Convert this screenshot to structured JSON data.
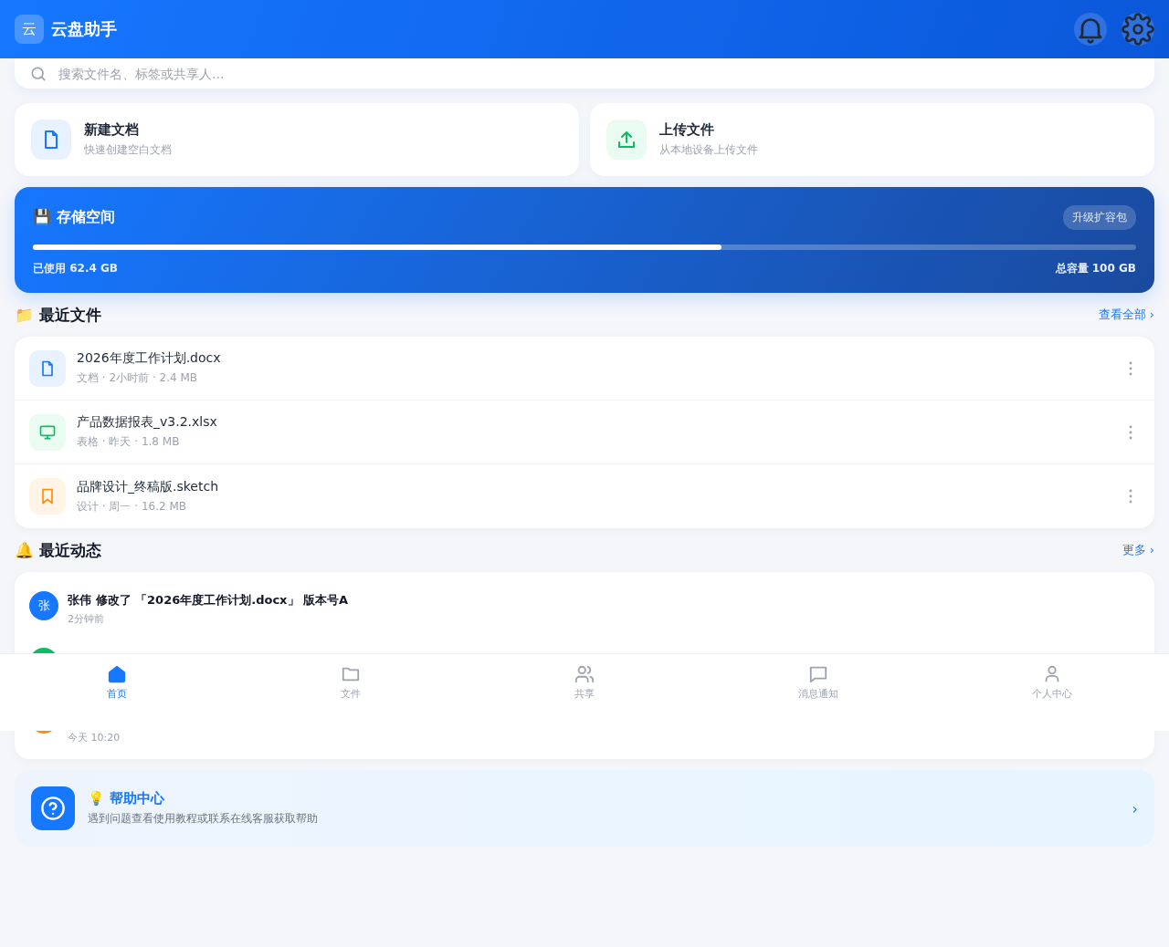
{
  "header": {
    "logo": "云",
    "title": "云盘助手"
  },
  "search": {
    "placeholder": "搜索文件名、标签或共享人..."
  },
  "quick_actions": [
    {
      "kind": "document",
      "title": "新建文档",
      "subtitle": "快速创建空白文档"
    },
    {
      "kind": "upload",
      "title": "上传文件",
      "subtitle": "从本地设备上传文件"
    }
  ],
  "storage": {
    "title": "💾 存储空间",
    "badge": "升级扩容包",
    "level": 0.624,
    "used": "已使用 62.4 GB",
    "total": "总容量 100 GB"
  },
  "recent_files": {
    "title": "📁 最近文件",
    "link": "查看全部 ›",
    "items": [
      {
        "kind": "document",
        "name": "2026年度工作计划.docx",
        "meta": "文档 · 2小时前 · 2.4 MB"
      },
      {
        "kind": "sheet",
        "name": "产品数据报表_v3.2.xlsx",
        "meta": "表格 · 昨天 · 1.8 MB"
      },
      {
        "kind": "design",
        "name": "品牌设计_终稿版.sketch",
        "meta": "设计 · 周一 · 16.2 MB"
      }
    ]
  },
  "activity": {
    "title": "🔔 最近动态",
    "link": "更多 ›",
    "items": [
      {
        "color": "#1677ff",
        "initial": "张",
        "text": "张伟 修改了 「2026年度工作计划.docx」 版本号A",
        "time": "2分钟前"
      },
      {
        "color": "#10b965"
      },
      {
        "color": "#ff8c0a",
        "time": "今天 10:20"
      }
    ]
  },
  "help": {
    "title": "💡 帮助中心",
    "description": "遇到问题查看使用教程或联系在线客服获取帮助",
    "arrow": "›"
  },
  "nav": [
    {
      "kind": "home",
      "label": "首页",
      "selected": true
    },
    {
      "kind": "folder",
      "label": "文件",
      "selected": false
    },
    {
      "kind": "people",
      "label": "共享",
      "selected": false
    },
    {
      "kind": "message",
      "label": "消息通知",
      "selected": false
    },
    {
      "kind": "user",
      "label": "个人中心",
      "selected": false
    }
  ]
}
